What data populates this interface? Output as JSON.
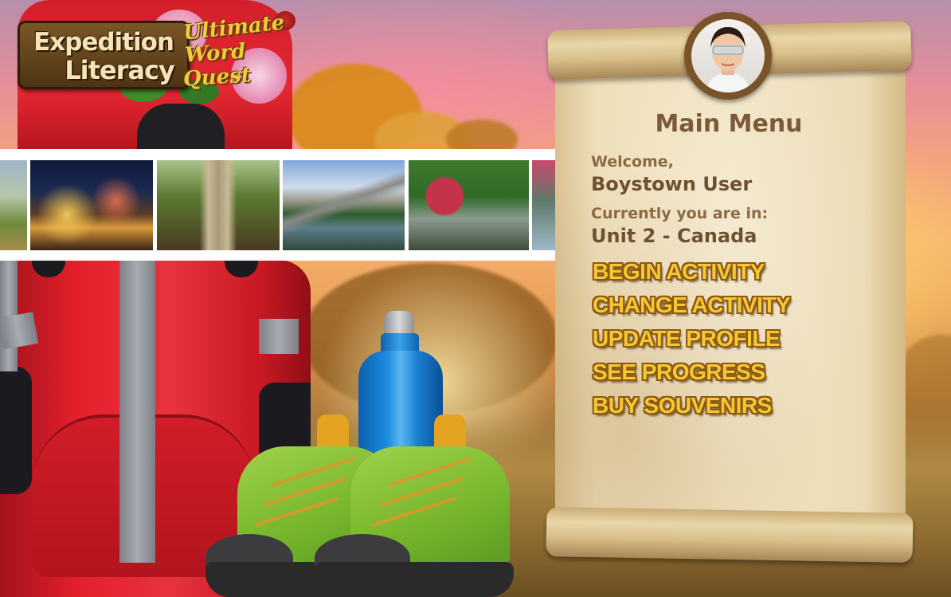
{
  "logo": {
    "line1": "Expedition",
    "line2": "Literacy",
    "subtitle_1": "Ultimate",
    "subtitle_2": "Word",
    "subtitle_3": "Quest"
  },
  "photo_strip": {
    "photos": [
      "grassland-photo",
      "city-night-photo",
      "rope-bridge-photo",
      "mountain-lake-photo",
      "japanese-garden-photo",
      "lake-photo"
    ]
  },
  "panel": {
    "title": "Main Menu",
    "welcome_label": "Welcome,",
    "user_name": "Boystown User",
    "location_label": "Currently you are in:",
    "location_value": "Unit 2 - Canada"
  },
  "menu": {
    "begin_activity": "BEGIN ACTIVITY",
    "change_activity": "CHANGE ACTIVITY",
    "update_profile": "UPDATE PROFILE",
    "see_progress": "SEE PROGRESS",
    "buy_souvenirs": "BUY SOUVENIRS"
  },
  "colors": {
    "button_text": "#f6c636",
    "button_outline": "#8a5a12",
    "panel_text": "#7a5a38",
    "parchment": "#f2e4c3"
  }
}
